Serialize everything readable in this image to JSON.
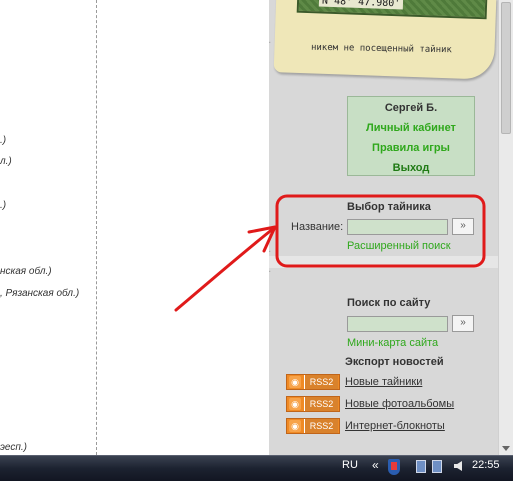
{
  "left_fragments": [
    ".)",
    "л.)",
    ".)",
    "нская обл.)",
    ", Рязанская обл.)",
    "эесп.)"
  ],
  "map_card": {
    "coordinate": "N 48° 47.980'",
    "tagline": "никем не посещенный тайник"
  },
  "user_box": {
    "name": "Сергей Б.",
    "cabinet": "Личный кабинет",
    "rules": "Правила игры",
    "logout": "Выход"
  },
  "cache_search": {
    "title": "Выбор тайника",
    "name_label": "Название:",
    "go": "»",
    "advanced": "Расширенный поиск"
  },
  "site_search": {
    "title": "Поиск по сайту",
    "go": "»",
    "sitemap": "Мини-карта сайта"
  },
  "news_export": {
    "title": "Экспорт новостей",
    "rss_label": "RSS2",
    "items": [
      "Новые тайники",
      "Новые фотоальбомы",
      "Интернет-блокноты"
    ]
  },
  "taskbar": {
    "language": "RU",
    "chevron": "«",
    "time": "22:55"
  },
  "colors": {
    "annotation": "#e01a1a",
    "link_green": "#2fa81c",
    "user_box_bg": "#c8dfc5",
    "rss_orange": "#f08a24"
  }
}
